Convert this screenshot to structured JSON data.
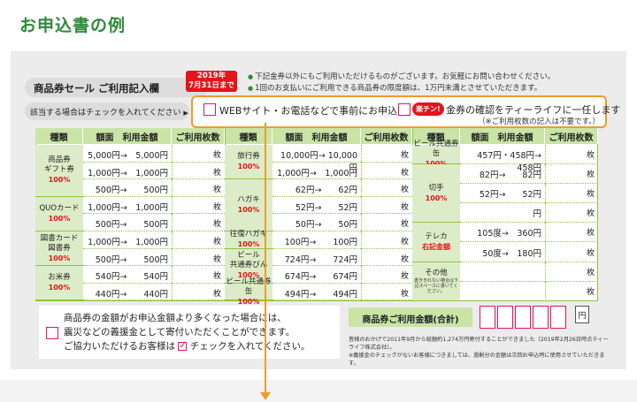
{
  "page_title": "お申込書の例",
  "form": {
    "header": "商品券セール ご利用記入欄",
    "date_badge": [
      "2019年",
      "7月31日まで"
    ],
    "notes": [
      "下記金券以外にもご利用いただけるものがございます。お気軽にお問い合わせください。",
      "1回のお支払いにご利用できる商品券の限度額は、1万円未満とさせていただきます。"
    ],
    "check_label": "該当する場合はチェックを入れてください",
    "option1": "WEBサイト・お電話などで事前にお申込済",
    "rakuchin_badge": "楽チン!",
    "option2": "金券の確認をティーライフに一任します",
    "option2_note": "（※ご利用枚数の記入は不要です。）",
    "columns": [
      "種類",
      "額面",
      "利用金額",
      "ご利用枚数"
    ],
    "mai": "枚",
    "arrow_color": "#f39a2a",
    "accent_green": "#2e8b3a",
    "accent_red": "#e5141b"
  },
  "groups": [
    {
      "categories": [
        {
          "name": "商品券\nギフト券",
          "pct": "100%",
          "rows": 3
        },
        {
          "name": "QUOカード",
          "pct": "100%",
          "rows": 2
        },
        {
          "name": "図書カード\n図書券",
          "pct": "100%",
          "rows": 2
        },
        {
          "name": "お米券",
          "pct": "100%",
          "rows": 2
        }
      ],
      "amounts": [
        "5,000円→　5,000円",
        "1,000円→　1,000円",
        "500円→　　500円",
        "1,000円→　1,000円",
        "500円→　　500円",
        "1,000円→　1,000円",
        "500円→　　500円",
        "540円→　　540円",
        "440円→　　440円"
      ]
    },
    {
      "categories": [
        {
          "name": "旅行券",
          "pct": "100%",
          "rows": 2
        },
        {
          "name": "ハガキ",
          "pct": "100%",
          "rows": 3
        },
        {
          "name": "往復ハガキ",
          "pct": "100%",
          "rows": 1
        },
        {
          "name": "ビール\n共通券びん",
          "pct": "100%",
          "rows": 2
        },
        {
          "name": "ビール共通券缶",
          "pct": "100%",
          "rows": 1
        }
      ],
      "amounts": [
        "10,000円→ 10,000円",
        "1,000円→　1,000円",
        "62円→　　62円",
        "52円→　　52円",
        "50円→　　50円",
        "100円→　　100円",
        "724円→　　724円",
        "674円→　　674円",
        "494円→　　494円"
      ]
    },
    {
      "categories": [
        {
          "name": "ビール共通券缶",
          "pct": "100%",
          "rows": 1
        },
        {
          "name": "切手",
          "pct": "100%",
          "rows": 3
        },
        {
          "name": "テレカ",
          "pct": "右記金額",
          "rows": 2
        },
        {
          "name": "その他",
          "pct": "書ききれない場合は下記スペースに書いてください。",
          "rows": 2
        }
      ],
      "amounts": [
        "457円・458円→　458円",
        "82円→　　82円",
        "52円→　　52円",
        "円",
        "105度→　360円",
        "50度→　180円",
        "",
        ""
      ]
    }
  ],
  "donation": {
    "line1": "商品券の金額がお申込金額より多くなった場合には、",
    "line2": "震災などの義援金として寄付いただくことができます。",
    "line3a": "ご協力いただけるお客様は",
    "line3b": "チェックを入れてください。"
  },
  "total": {
    "label": "商品券ご利用金額(合計)",
    "yen": "円"
  },
  "footnote": [
    "皆様のおかげで2011年9月から総額約1,274万円寄付することができました（2019年2月26日時点ティーライフ株式会社）。",
    "※義援金のチェックがないお客様につきましては、過剰分の金額は次回お申込時に使用させていただきます。"
  ]
}
